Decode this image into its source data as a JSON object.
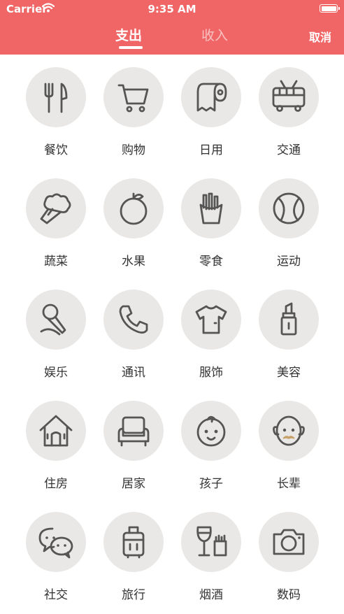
{
  "status": {
    "carrier": "Carrier",
    "time": "9:35 AM"
  },
  "nav": {
    "tabs": [
      {
        "label": "支出",
        "selected": true
      },
      {
        "label": "收入",
        "selected": false
      }
    ],
    "cancel_label": "取消"
  },
  "colors": {
    "header": "#f06565",
    "icon_bg": "#eae8e6",
    "icon_stroke": "#555555"
  },
  "categories": [
    {
      "label": "餐饮",
      "icon": "fork-knife-icon"
    },
    {
      "label": "购物",
      "icon": "shopping-cart-icon"
    },
    {
      "label": "日用",
      "icon": "toilet-paper-icon"
    },
    {
      "label": "交通",
      "icon": "trolleybus-icon"
    },
    {
      "label": "蔬菜",
      "icon": "broccoli-icon"
    },
    {
      "label": "水果",
      "icon": "orange-icon"
    },
    {
      "label": "零食",
      "icon": "fries-icon"
    },
    {
      "label": "运动",
      "icon": "baseball-icon"
    },
    {
      "label": "娱乐",
      "icon": "microphone-icon"
    },
    {
      "label": "通讯",
      "icon": "phone-icon"
    },
    {
      "label": "服饰",
      "icon": "tshirt-icon"
    },
    {
      "label": "美容",
      "icon": "lipstick-icon"
    },
    {
      "label": "住房",
      "icon": "house-icon"
    },
    {
      "label": "居家",
      "icon": "sofa-icon"
    },
    {
      "label": "孩子",
      "icon": "baby-icon"
    },
    {
      "label": "长辈",
      "icon": "elder-icon"
    },
    {
      "label": "社交",
      "icon": "chat-bubbles-icon"
    },
    {
      "label": "旅行",
      "icon": "suitcase-icon"
    },
    {
      "label": "烟酒",
      "icon": "wine-cigarette-icon"
    },
    {
      "label": "数码",
      "icon": "camera-icon"
    }
  ]
}
